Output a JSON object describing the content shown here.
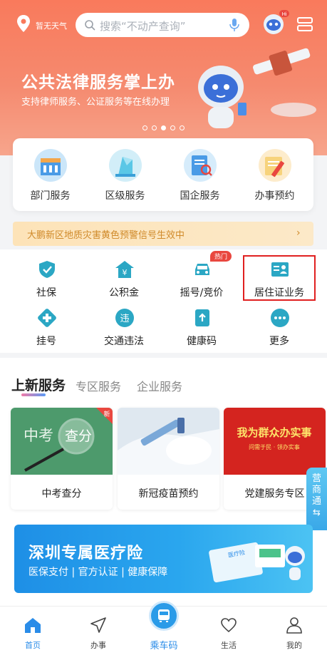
{
  "header": {
    "weather": "暂无天气",
    "search_placeholder": "搜索“不动产查询”",
    "robot_badge": "Hi"
  },
  "banner": {
    "title": "公共法律服务掌上办",
    "subtitle": "支持律师服务、公证服务等在线办理",
    "slide_count": 5,
    "active_slide": 3
  },
  "dept_card": [
    {
      "label": "部门服务",
      "icon": "building-icon"
    },
    {
      "label": "区级服务",
      "icon": "crystal-building-icon"
    },
    {
      "label": "国企服务",
      "icon": "search-document-icon"
    },
    {
      "label": "办事预约",
      "icon": "pencil-calendar-icon"
    }
  ],
  "alert": {
    "text": "大鹏新区地质灾害黄色预警信号生效中",
    "arrow": "›"
  },
  "quick": [
    {
      "label": "社保",
      "icon": "shield-check-icon"
    },
    {
      "label": "公积金",
      "icon": "house-yen-icon"
    },
    {
      "label": "摇号/竞价",
      "icon": "car-icon",
      "badge": "热门"
    },
    {
      "label": "居住证业务",
      "icon": "id-card-icon"
    },
    {
      "label": "挂号",
      "icon": "medical-cross-icon"
    },
    {
      "label": "交通违法",
      "icon": "violation-icon",
      "glyph": "违"
    },
    {
      "label": "健康码",
      "icon": "health-code-icon"
    },
    {
      "label": "更多",
      "icon": "more-icon"
    }
  ],
  "tabs": [
    "上新服务",
    "专区服务",
    "企业服务"
  ],
  "services": [
    {
      "label": "中考查分",
      "art_text_1": "中考",
      "art_text_2": "查分",
      "badge": "新"
    },
    {
      "label": "新冠疫苗预约"
    },
    {
      "label": "党建服务专区",
      "art_text_1": "我为群众办实事",
      "art_text_2": "问需于民 · 领办实事"
    }
  ],
  "side_tab": {
    "line1": "营",
    "line2": "商",
    "line3": "通",
    "line4": "⇆"
  },
  "insurance": {
    "title": "深圳专属医疗险",
    "subtitle": "医保支付 | 官方认证 | 健康保障",
    "card_text": "医疗险"
  },
  "nav": [
    {
      "label": "首页",
      "icon": "home-icon"
    },
    {
      "label": "办事",
      "icon": "send-icon"
    },
    {
      "label": "乘车码",
      "icon": "bus-icon"
    },
    {
      "label": "生活",
      "icon": "heart-icon"
    },
    {
      "label": "我的",
      "icon": "user-icon"
    }
  ],
  "colors": {
    "hero": "#f97a5c",
    "accent": "#2a8ce8",
    "alert_bg": "#fde3b8",
    "alert_text": "#d08a2a",
    "highlight": "#e02020"
  }
}
